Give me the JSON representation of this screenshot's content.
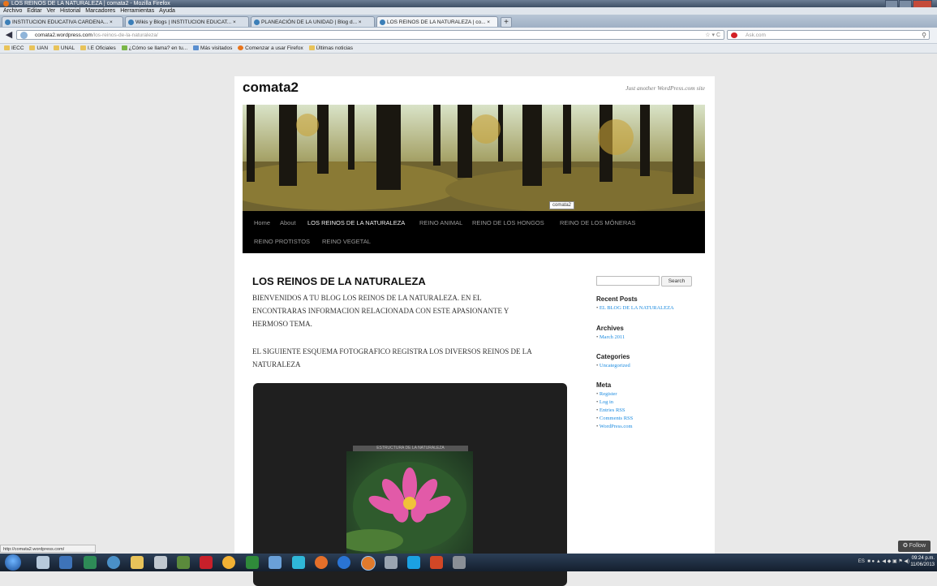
{
  "window": {
    "title": "LOS REINOS DE LA NATURALEZA | comata2 - Mozilla Firefox"
  },
  "menu": [
    "Archivo",
    "Editar",
    "Ver",
    "Historial",
    "Marcadores",
    "Herramientas",
    "Ayuda"
  ],
  "tabs": [
    {
      "label": "INSTITUCION EDUCATIVA CARDENA... ×"
    },
    {
      "label": "Wikis y Blogs | INSTITUCION EDUCAT... ×"
    },
    {
      "label": "PLANEACIÓN DE LA UNIDAD | Blog d... ×"
    },
    {
      "label": "LOS REINOS DE LA NATURALEZA | co... ×"
    }
  ],
  "newtab": "+",
  "address": {
    "domain": "comata2.wordpress.com",
    "path": "/los-reinos-de-la-naturaleza/"
  },
  "search": {
    "placeholder": "Ask.com"
  },
  "bookmarks": [
    "IECC",
    "UAN",
    "UNAL",
    "I.E Oficiales",
    "¿Cómo se llama? en tu...",
    "Más visitados",
    "Comenzar a usar Firefox",
    "Últimas noticias"
  ],
  "blog": {
    "title": "comata2",
    "tagline": "Just another WordPress.com site",
    "header_tooltip": "comata2",
    "nav": [
      "Home",
      "About",
      "LOS REINOS DE LA NATURALEZA",
      "REINO ANIMAL",
      "REINO DE LOS HONGOS",
      "REINO DE LOS MÓNERAS",
      "REINO PROTISTOS",
      "REINO VEGETAL"
    ]
  },
  "post": {
    "title": "LOS REINOS DE LA NATURALEZA",
    "p1": [
      "BIENVENIDOS  A TU  BLOG LOS REINOS DE LA NATURALEZA.  EN EL",
      "ENCONTRARAS INFORMACION RELACIONADA CON ESTE APASIONANTE Y",
      "HERMOSO TEMA."
    ],
    "p2": [
      "EL SIGUIENTE ESQUEMA FOTOGRAFICO REGISTRA LOS DIVERSOS REINOS DE LA",
      "NATURALEZA"
    ],
    "gallery_caption": "ESTRUCTURA DE LA NATURALEZA"
  },
  "sidebar": {
    "search_button": "Search",
    "recent_posts": {
      "heading": "Recent Posts",
      "items": [
        "EL BLOG DE LA NATURALEZA"
      ]
    },
    "archives": {
      "heading": "Archives",
      "items": [
        "March 2011"
      ]
    },
    "categories": {
      "heading": "Categories",
      "items": [
        "Uncategorized"
      ]
    },
    "meta": {
      "heading": "Meta",
      "items": [
        "Register",
        "Log in",
        "Entries RSS",
        "Comments RSS",
        "WordPress.com"
      ]
    }
  },
  "status": "http://comata2.wordpress.com/",
  "follow": "✪ Follow",
  "taskbar": {
    "lang": "ES",
    "time": "09:24 p.m.",
    "date": "11/06/2013"
  }
}
